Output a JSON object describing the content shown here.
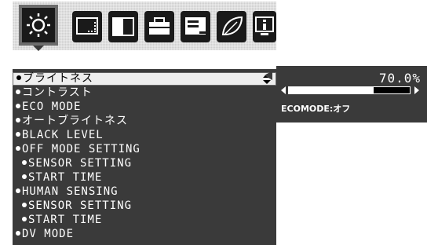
{
  "toolbar": {
    "tabs": [
      {
        "icon": "brightness-sun-icon",
        "selected": true
      },
      {
        "icon": "screen-size-icon",
        "selected": false
      },
      {
        "icon": "color-contrast-icon",
        "selected": false
      },
      {
        "icon": "toolbox-icon",
        "selected": false
      },
      {
        "icon": "osd-menu-icon",
        "selected": false
      },
      {
        "icon": "eco-leaf-icon",
        "selected": false
      },
      {
        "icon": "information-icon",
        "selected": false
      }
    ]
  },
  "menu": {
    "items": [
      {
        "label": "ブライトネス",
        "selected": true,
        "sub": false
      },
      {
        "label": "コントラスト",
        "selected": false,
        "sub": false
      },
      {
        "label": "ECO MODE",
        "selected": false,
        "sub": false
      },
      {
        "label": "オートブライトネス",
        "selected": false,
        "sub": false
      },
      {
        "label": "BLACK LEVEL",
        "selected": false,
        "sub": false
      },
      {
        "label": "OFF MODE SETTING",
        "selected": false,
        "sub": false
      },
      {
        "label": "SENSOR SETTING",
        "selected": false,
        "sub": true
      },
      {
        "label": "START TIME",
        "selected": false,
        "sub": true
      },
      {
        "label": "HUMAN SENSING",
        "selected": false,
        "sub": false
      },
      {
        "label": "SENSOR SETTING",
        "selected": false,
        "sub": true
      },
      {
        "label": "START TIME",
        "selected": false,
        "sub": true
      },
      {
        "label": "DV MODE",
        "selected": false,
        "sub": false
      }
    ]
  },
  "value_panel": {
    "value_text": "70.0%",
    "level": 0.7,
    "eco_status": "ECOMODE:オフ"
  },
  "colors": {
    "panel_bg": "#3a3a3a",
    "tab_bg": "#1a1a1a",
    "active_tab_bg": "#6c6c6c",
    "text": "#ffffff",
    "selected_bg": "#eeeeee"
  }
}
